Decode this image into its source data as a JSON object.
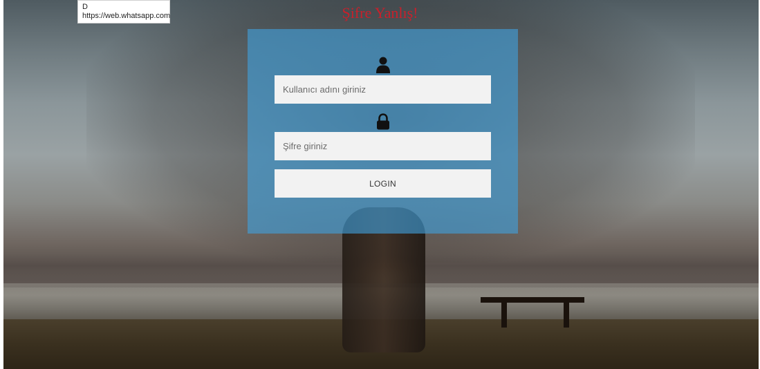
{
  "page": {
    "error_message": "Şifre Yanlış!",
    "error_color": "#c8202b"
  },
  "tooltip": {
    "line1": "D",
    "line2": "https://web.whatsapp.com"
  },
  "login": {
    "panel_color": "#40a0dc",
    "username_placeholder": "Kullanıcı adını giriniz",
    "password_placeholder": "Şifre giriniz",
    "button_label": "LOGIN",
    "username_icon": "user-icon",
    "password_icon": "lock-icon"
  }
}
